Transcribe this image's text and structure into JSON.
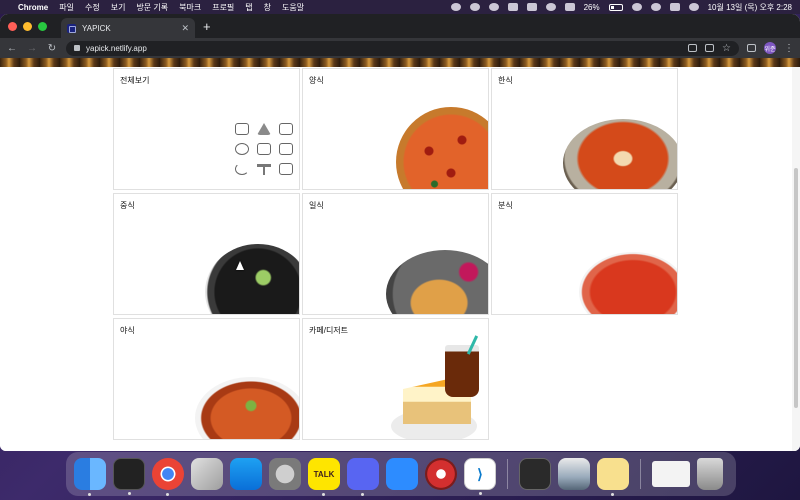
{
  "menubar": {
    "app_name": "Chrome",
    "menus": [
      "파일",
      "수정",
      "보기",
      "방문 기록",
      "북마크",
      "프로필",
      "탭",
      "창",
      "도움말"
    ],
    "battery": "26%",
    "datetime": "10월 13일 (목) 오후 2:28"
  },
  "browser": {
    "tab_title": "YAPICK",
    "tab_close": "✕",
    "new_tab": "+",
    "url": "yapick.netlify.app",
    "profile_initial": "위준"
  },
  "categories": [
    {
      "label": "전체보기",
      "image": "icon-grid"
    },
    {
      "label": "양식",
      "image": "pizza"
    },
    {
      "label": "한식",
      "image": "stew"
    },
    {
      "label": "중식",
      "image": "jjajangmyeon"
    },
    {
      "label": "일식",
      "image": "katsu"
    },
    {
      "label": "분식",
      "image": "tteokbokki"
    },
    {
      "label": "야식",
      "image": "spaghetti"
    },
    {
      "label": "카페/디저트",
      "image": "cake-and-coffee"
    }
  ],
  "category_icons": [
    "chicken-icon",
    "pizza-slice-icon",
    "noodle-bowl-icon",
    "rice-bowl-icon",
    "lunchbox-icon",
    "sushi-icon",
    "moon-icon",
    "skewer-icon",
    "burger-icon"
  ],
  "dock": {
    "apps": [
      "Finder",
      "Terminal",
      "Chrome",
      "Launchpad",
      "App Store",
      "System Preferences",
      "KakaoTalk",
      "Discord",
      "Zoom",
      "Safari-like",
      "VS Code",
      "QuickTime",
      "Preview",
      "Notes",
      "Chrome Window",
      "Trash"
    ],
    "talk_label": "TALK"
  }
}
